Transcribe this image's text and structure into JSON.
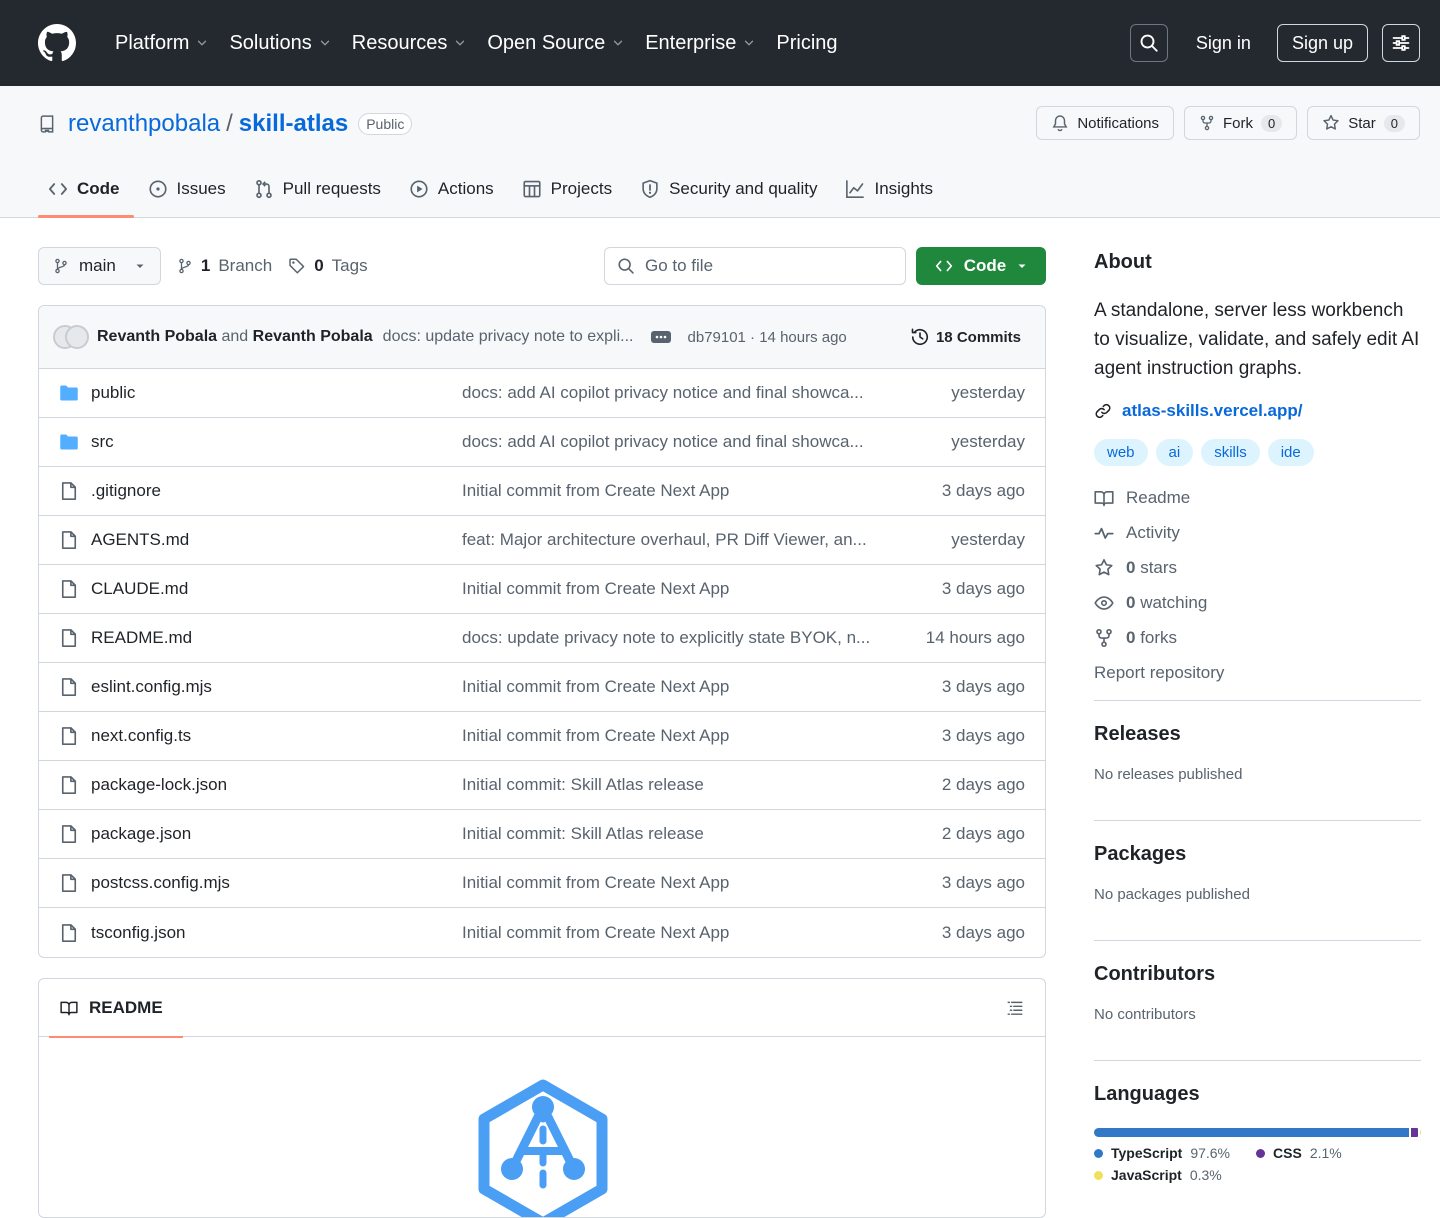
{
  "header": {
    "nav": [
      {
        "label": "Platform",
        "dropdown": true
      },
      {
        "label": "Solutions",
        "dropdown": true
      },
      {
        "label": "Resources",
        "dropdown": true
      },
      {
        "label": "Open Source",
        "dropdown": true
      },
      {
        "label": "Enterprise",
        "dropdown": true
      },
      {
        "label": "Pricing",
        "dropdown": false
      }
    ],
    "sign_in": "Sign in",
    "sign_up": "Sign up"
  },
  "repo": {
    "owner": "revanthpobala",
    "separator": "/",
    "name": "skill-atlas",
    "visibility": "Public",
    "notifications_label": "Notifications",
    "fork_label": "Fork",
    "fork_count": "0",
    "star_label": "Star",
    "star_count": "0"
  },
  "tabs": [
    {
      "label": "Code",
      "icon": "code-icon",
      "active": true
    },
    {
      "label": "Issues",
      "icon": "issue-icon",
      "active": false
    },
    {
      "label": "Pull requests",
      "icon": "pull-request-icon",
      "active": false
    },
    {
      "label": "Actions",
      "icon": "play-icon",
      "active": false
    },
    {
      "label": "Projects",
      "icon": "table-icon",
      "active": false
    },
    {
      "label": "Security and quality",
      "icon": "shield-icon",
      "active": false
    },
    {
      "label": "Insights",
      "icon": "graph-icon",
      "active": false
    }
  ],
  "toolbar": {
    "branch": "main",
    "branch_count": "1",
    "branch_word": "Branch",
    "tag_count": "0",
    "tag_word": "Tags",
    "goto_placeholder": "Go to file",
    "code_button": "Code"
  },
  "commit": {
    "author1": "Revanth Pobala",
    "and": "and",
    "author2": "Revanth Pobala",
    "message": "docs: update privacy note to expli...",
    "hash_time": "db79101 · 14 hours ago",
    "commits_label": "18 Commits"
  },
  "files": [
    {
      "type": "dir",
      "name": "public",
      "message": "docs: add AI copilot privacy notice and final showca...",
      "time": "yesterday"
    },
    {
      "type": "dir",
      "name": "src",
      "message": "docs: add AI copilot privacy notice and final showca...",
      "time": "yesterday"
    },
    {
      "type": "file",
      "name": ".gitignore",
      "message": "Initial commit from Create Next App",
      "time": "3 days ago"
    },
    {
      "type": "file",
      "name": "AGENTS.md",
      "message": "feat: Major architecture overhaul, PR Diff Viewer, an...",
      "time": "yesterday"
    },
    {
      "type": "file",
      "name": "CLAUDE.md",
      "message": "Initial commit from Create Next App",
      "time": "3 days ago"
    },
    {
      "type": "file",
      "name": "README.md",
      "message": "docs: update privacy note to explicitly state BYOK, n...",
      "time": "14 hours ago"
    },
    {
      "type": "file",
      "name": "eslint.config.mjs",
      "message": "Initial commit from Create Next App",
      "time": "3 days ago"
    },
    {
      "type": "file",
      "name": "next.config.ts",
      "message": "Initial commit from Create Next App",
      "time": "3 days ago"
    },
    {
      "type": "file",
      "name": "package-lock.json",
      "message": "Initial commit: Skill Atlas release",
      "time": "2 days ago"
    },
    {
      "type": "file",
      "name": "package.json",
      "message": "Initial commit: Skill Atlas release",
      "time": "2 days ago"
    },
    {
      "type": "file",
      "name": "postcss.config.mjs",
      "message": "Initial commit from Create Next App",
      "time": "3 days ago"
    },
    {
      "type": "file",
      "name": "tsconfig.json",
      "message": "Initial commit from Create Next App",
      "time": "3 days ago"
    }
  ],
  "readme": {
    "tab_label": "README"
  },
  "about": {
    "title": "About",
    "description": "A standalone, server less workbench to visualize, validate, and safely edit AI agent instruction graphs.",
    "link": "atlas-skills.vercel.app/",
    "topics": [
      "web",
      "ai",
      "skills",
      "ide"
    ],
    "meta": [
      {
        "icon": "book-icon",
        "count": "",
        "label": "Readme"
      },
      {
        "icon": "pulse-icon",
        "count": "",
        "label": "Activity"
      },
      {
        "icon": "star-icon",
        "count": "0",
        "label": "stars"
      },
      {
        "icon": "eye-icon",
        "count": "0",
        "label": "watching"
      },
      {
        "icon": "fork-icon",
        "count": "0",
        "label": "forks"
      },
      {
        "icon": "",
        "count": "",
        "label": "Report repository"
      }
    ]
  },
  "sections": [
    {
      "title": "Releases",
      "sub": "No releases published"
    },
    {
      "title": "Packages",
      "sub": "No packages published"
    },
    {
      "title": "Contributors",
      "sub": "No contributors"
    }
  ],
  "languages": {
    "title": "Languages",
    "items": [
      {
        "name": "TypeScript",
        "percent": "97.6%",
        "value": 97.6,
        "color": "#3178c6"
      },
      {
        "name": "CSS",
        "percent": "2.1%",
        "value": 2.1,
        "color": "#663399"
      },
      {
        "name": "JavaScript",
        "percent": "0.3%",
        "value": 0.3,
        "color": "#f1e05a"
      }
    ]
  },
  "colors": {
    "accent": "#0969da",
    "primary_button": "#1f883d",
    "header_bg": "#24292f",
    "tab_underline": "#fd8c73"
  }
}
